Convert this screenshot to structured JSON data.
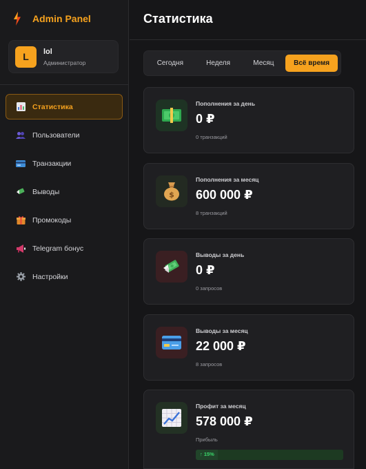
{
  "brand": {
    "title": "Admin Panel",
    "icon": "lightning-icon"
  },
  "user": {
    "initial": "L",
    "name": "lol",
    "role": "Администратор"
  },
  "nav": [
    {
      "label": "Статистика",
      "icon": "chart-icon",
      "active": true
    },
    {
      "label": "Пользователи",
      "icon": "users-icon"
    },
    {
      "label": "Транзакции",
      "icon": "card-icon"
    },
    {
      "label": "Выводы",
      "icon": "money-wings-icon"
    },
    {
      "label": "Промокоды",
      "icon": "gift-icon"
    },
    {
      "label": "Telegram бонус",
      "icon": "megaphone-icon"
    },
    {
      "label": "Настройки",
      "icon": "gear-icon"
    }
  ],
  "page": {
    "title": "Статистика"
  },
  "tabs": [
    {
      "label": "Сегодня"
    },
    {
      "label": "Неделя"
    },
    {
      "label": "Месяц"
    },
    {
      "label": "Всё время",
      "active": true
    }
  ],
  "cards": [
    {
      "label": "Пополнения за день",
      "value": "0 ₽",
      "sub": "0 транзакций",
      "icon": "cash-icon",
      "icon_bg": "#1e3324"
    },
    {
      "label": "Пополнения за месяц",
      "value": "600 000 ₽",
      "sub": "8 транзакций",
      "icon": "money-bag-icon",
      "icon_bg": "#232a22"
    },
    {
      "label": "Выводы за день",
      "value": "0 ₽",
      "sub": "0 запросов",
      "icon": "money-wings-icon",
      "icon_bg": "#3a1f22"
    },
    {
      "label": "Выводы за месяц",
      "value": "22 000 ₽",
      "sub": "8 запросов",
      "icon": "credit-card-icon",
      "icon_bg": "#3a1f22"
    },
    {
      "label": "Профит за месяц",
      "value": "578 000 ₽",
      "sub": "Прибыль",
      "icon": "trend-up-icon",
      "icon_bg": "#233124",
      "trend": "↑ 15%",
      "trend_fraction": 0.15
    }
  ],
  "colors": {
    "accent": "#f6a21e",
    "positive": "#3ad66a"
  }
}
